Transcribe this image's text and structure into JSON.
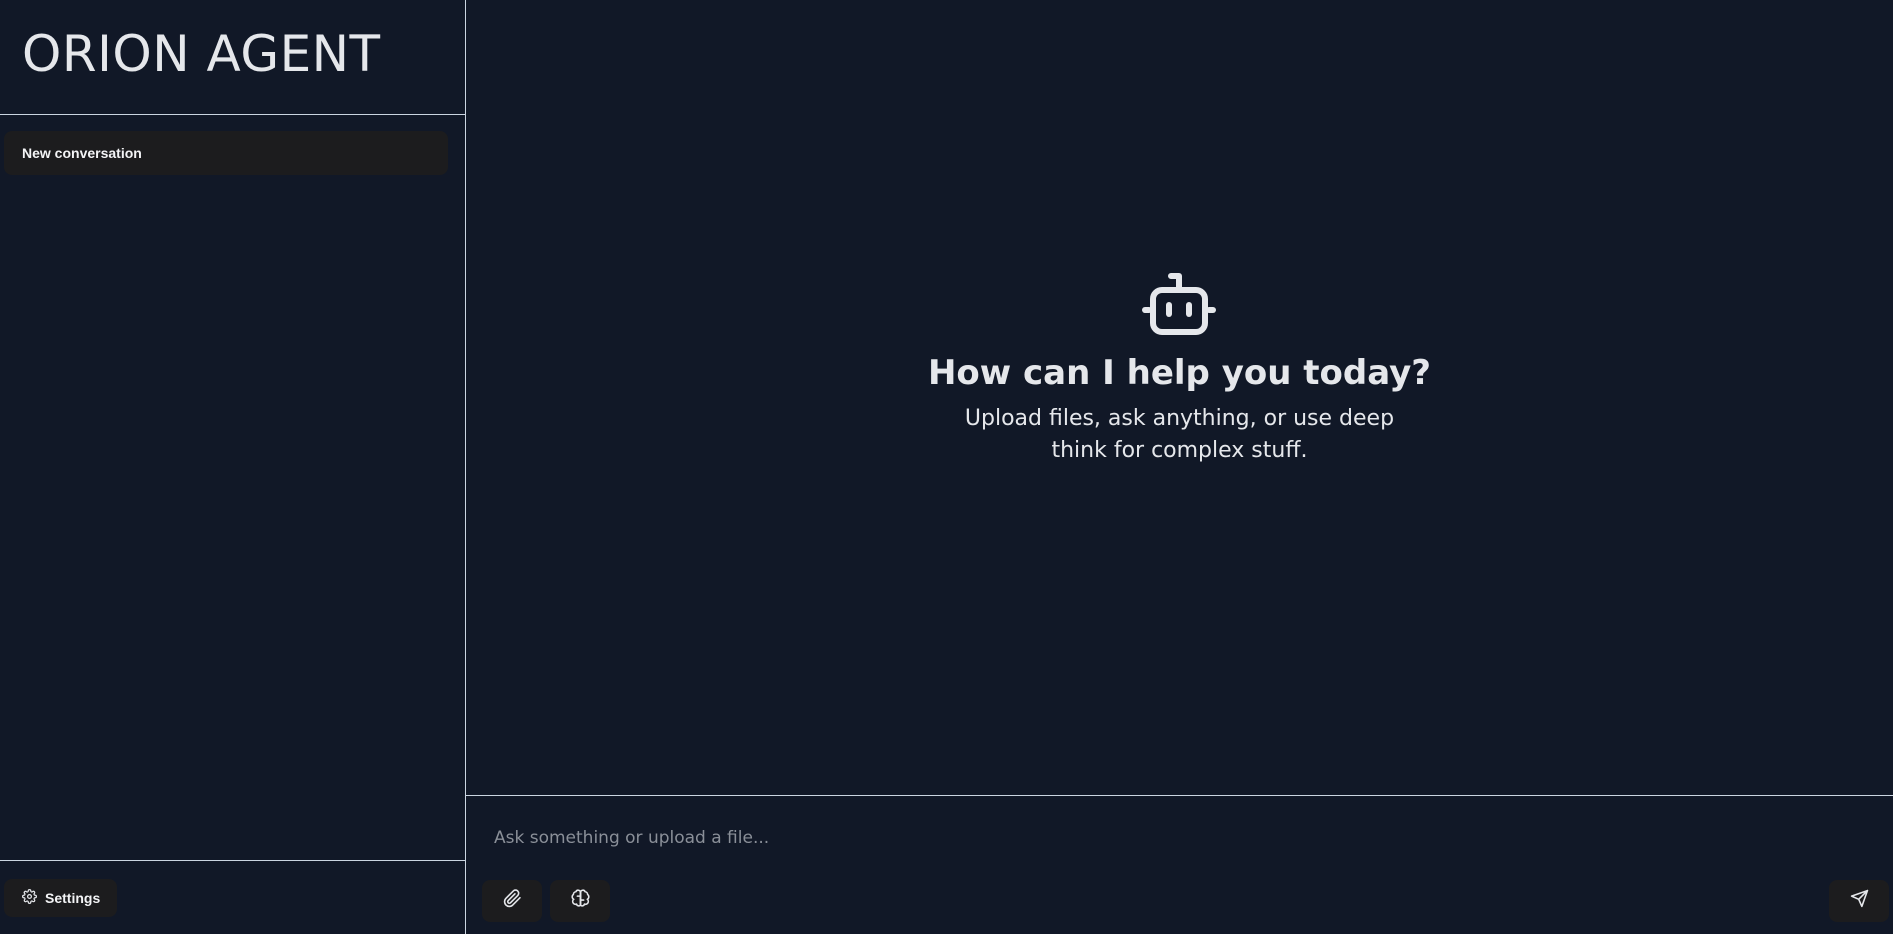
{
  "app": {
    "title": "ORION AGENT"
  },
  "sidebar": {
    "conversations": [
      {
        "label": "New conversation"
      }
    ],
    "settings_label": "Settings",
    "settings_icon": "gear-icon"
  },
  "main": {
    "welcome": {
      "icon": "bot-icon",
      "title": "How can I help you today?",
      "subtitle": "Upload files, ask anything, or use deep think for complex stuff."
    }
  },
  "composer": {
    "placeholder": "Ask something or upload a file...",
    "attach_icon": "paperclip-icon",
    "deep_think_icon": "brain-icon",
    "send_icon": "send-icon"
  },
  "colors": {
    "background": "#111827",
    "surface": "#1c1c1e",
    "border": "#cbd5e1",
    "text": "#e5e7eb",
    "placeholder": "#8a8f98"
  }
}
